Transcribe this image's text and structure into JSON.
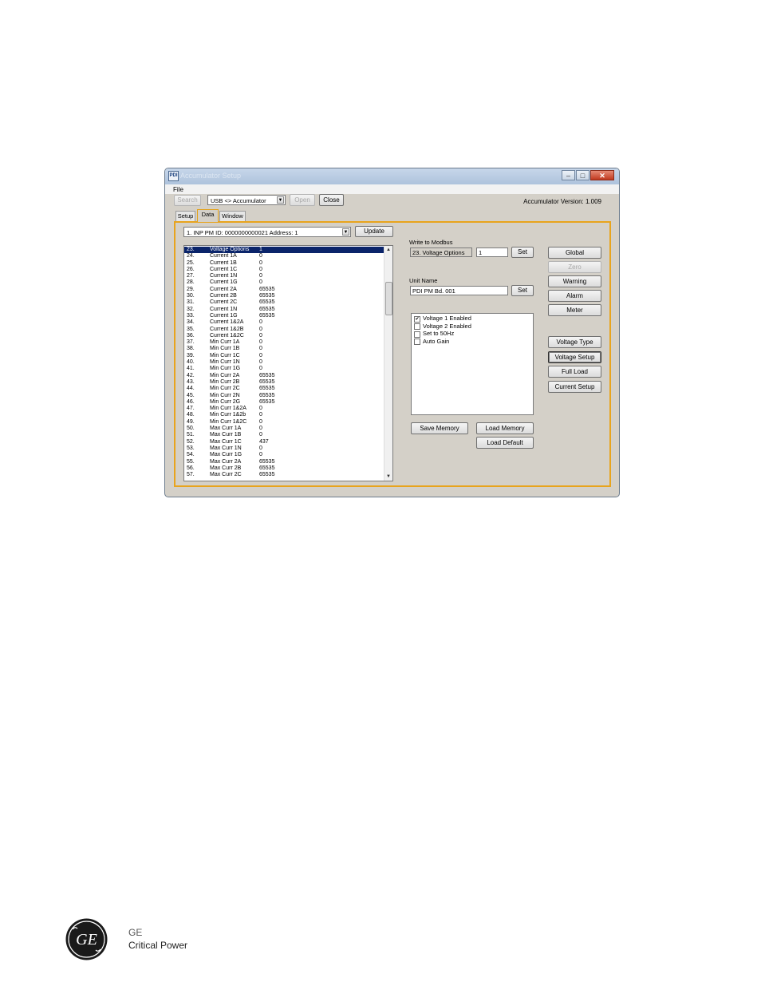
{
  "window": {
    "icon_text": "PDI",
    "title": "Accumulator Setup",
    "controls": {
      "minimize": "–",
      "maximize": "□",
      "close": "✕"
    }
  },
  "menu": {
    "file": "File"
  },
  "toolbar": {
    "search_label": "Search",
    "connection_value": "USB <> Accumulator",
    "open_label": "Open",
    "close_label": "Close",
    "version_text": "Accumulator Version: 1.009"
  },
  "tabs": [
    {
      "label": "Setup"
    },
    {
      "label": "Data"
    },
    {
      "label": "Window"
    }
  ],
  "device": {
    "selector_value": "1.  INP PM   ID: 0000000000021   Address: 1",
    "update_label": "Update"
  },
  "registers": [
    {
      "num": "23.",
      "name": "Voltage Options",
      "value": "1"
    },
    {
      "num": "24.",
      "name": "Current 1A",
      "value": "0"
    },
    {
      "num": "25.",
      "name": "Current 1B",
      "value": "0"
    },
    {
      "num": "26.",
      "name": "Current 1C",
      "value": "0"
    },
    {
      "num": "27.",
      "name": "Current 1N",
      "value": "0"
    },
    {
      "num": "28.",
      "name": "Current 1G",
      "value": "0"
    },
    {
      "num": "29.",
      "name": "Current 2A",
      "value": "65535"
    },
    {
      "num": "30.",
      "name": "Current 2B",
      "value": "65535"
    },
    {
      "num": "31.",
      "name": "Current 2C",
      "value": "65535"
    },
    {
      "num": "32.",
      "name": "Current 1N",
      "value": "65535"
    },
    {
      "num": "33.",
      "name": "Current 1G",
      "value": "65535"
    },
    {
      "num": "34.",
      "name": "Current 1&2A",
      "value": "0"
    },
    {
      "num": "35.",
      "name": "Current 1&2B",
      "value": "0"
    },
    {
      "num": "36.",
      "name": "Current 1&2C",
      "value": "0"
    },
    {
      "num": "37.",
      "name": "Min Curr 1A",
      "value": "0"
    },
    {
      "num": "38.",
      "name": "Min Curr 1B",
      "value": "0"
    },
    {
      "num": "39.",
      "name": "Min Curr 1C",
      "value": "0"
    },
    {
      "num": "40.",
      "name": "Min Curr 1N",
      "value": "0"
    },
    {
      "num": "41.",
      "name": "Min Curr 1G",
      "value": "0"
    },
    {
      "num": "42.",
      "name": "Min Curr 2A",
      "value": "65535"
    },
    {
      "num": "43.",
      "name": "Min Curr 2B",
      "value": "65535"
    },
    {
      "num": "44.",
      "name": "Min Curr 2C",
      "value": "65535"
    },
    {
      "num": "45.",
      "name": "Min Curr 2N",
      "value": "65535"
    },
    {
      "num": "46.",
      "name": "Min Curr 2G",
      "value": "65535"
    },
    {
      "num": "47.",
      "name": "Min Curr 1&2A",
      "value": "0"
    },
    {
      "num": "48.",
      "name": "Min Curr 1&2b",
      "value": "0"
    },
    {
      "num": "49.",
      "name": "Min Curr 1&2C",
      "value": "0"
    },
    {
      "num": "50.",
      "name": "Max Curr 1A",
      "value": "0"
    },
    {
      "num": "51.",
      "name": "Max Curr 1B",
      "value": "0"
    },
    {
      "num": "52.",
      "name": "Max Curr 1C",
      "value": "437"
    },
    {
      "num": "53.",
      "name": "Max Curr 1N",
      "value": "0"
    },
    {
      "num": "54.",
      "name": "Max Curr 1G",
      "value": "0"
    },
    {
      "num": "55.",
      "name": "Max Curr 2A",
      "value": "65535"
    },
    {
      "num": "56.",
      "name": "Max Curr 2B",
      "value": "65535"
    },
    {
      "num": "57.",
      "name": "Max Curr 2C",
      "value": "65535"
    }
  ],
  "modbus": {
    "label": "Write to Modbus",
    "register_value": "23. Voltage Options",
    "value": "1",
    "set_label": "Set"
  },
  "unit_name": {
    "label": "Unit Name",
    "value": "PDI PM Bd. 001",
    "set_label": "Set"
  },
  "options": [
    {
      "label": "Voltage 1 Enabled",
      "checked": true
    },
    {
      "label": "Voltage 2 Enabled",
      "checked": false
    },
    {
      "label": "Set to 50Hz",
      "checked": false
    },
    {
      "label": "Auto Gain",
      "checked": false
    }
  ],
  "memory": {
    "save_label": "Save Memory",
    "load_label": "Load Memory",
    "default_label": "Load Default"
  },
  "side_buttons": {
    "global": "Global",
    "zero": "Zero",
    "warning": "Warning",
    "alarm": "Alarm",
    "meter": "Meter",
    "voltage_type": "Voltage Type",
    "voltage_setup": "Voltage Setup",
    "full_load": "Full Load",
    "current_setup": "Current Setup"
  },
  "footer": {
    "logo_text": "GE",
    "brand_line1": "GE",
    "brand_line2": "Critical Power"
  }
}
